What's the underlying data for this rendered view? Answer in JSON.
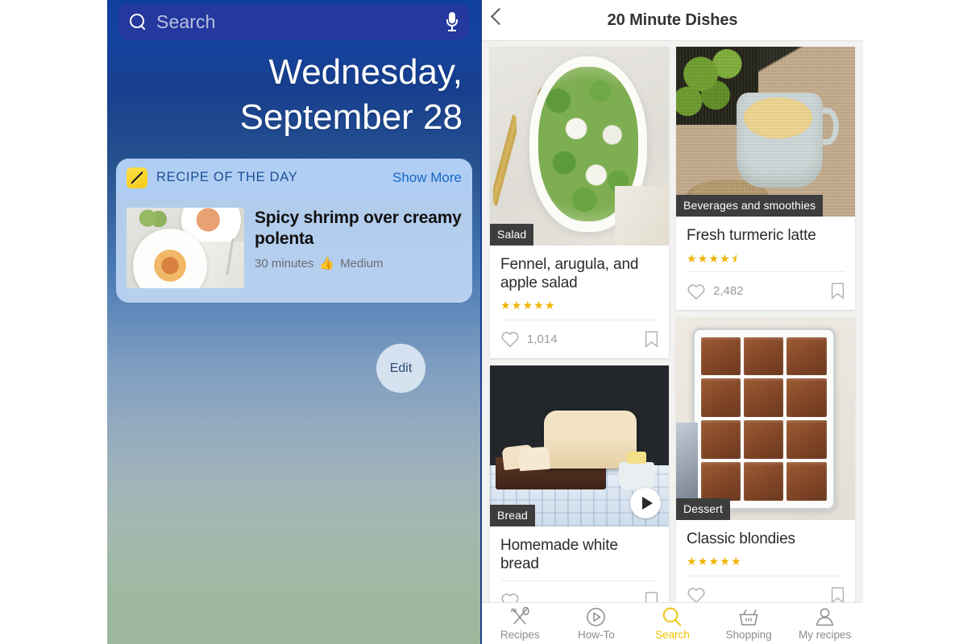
{
  "left_phone": {
    "search": {
      "placeholder": "Search",
      "icon": "search-icon",
      "mic_icon": "microphone-icon"
    },
    "date": {
      "line1": "Wednesday,",
      "line2": "September 28"
    },
    "widget": {
      "app_icon": "recipe-whisk-icon",
      "title": "RECIPE OF THE DAY",
      "show_more": "Show More",
      "recipe": {
        "name": "Spicy shrimp over creamy polenta",
        "time": "30 minutes",
        "difficulty_icon": "thumbs-up-icon",
        "difficulty": "Medium",
        "thumbnail": "spicy-shrimp-polenta-photo"
      }
    },
    "edit_button": "Edit"
  },
  "right_phone": {
    "header": {
      "back_icon": "chevron-left-icon",
      "title": "20 Minute Dishes"
    },
    "cards": [
      {
        "photo": "fennel-arugula-apple-salad-photo",
        "tag": "Salad",
        "title": "Fennel, arugula, and apple salad",
        "rating": 5,
        "rating_display": "★★★★★",
        "likes": "1,014",
        "has_video": false,
        "like_icon": "heart-icon",
        "save_icon": "bookmark-icon"
      },
      {
        "photo": "fresh-turmeric-latte-photo",
        "tag": "Beverages and smoothies",
        "title": "Fresh turmeric latte",
        "rating": 4.5,
        "rating_display": "★★★★⯨",
        "likes": "2,482",
        "has_video": false,
        "like_icon": "heart-icon",
        "save_icon": "bookmark-icon"
      },
      {
        "photo": "homemade-white-bread-photo",
        "tag": "Bread",
        "title": "Homemade white bread",
        "rating": null,
        "rating_display": "",
        "likes": "",
        "has_video": true,
        "video_icon": "play-icon",
        "like_icon": "heart-icon",
        "save_icon": "bookmark-icon"
      },
      {
        "photo": "classic-blondies-photo",
        "tag": "Dessert",
        "title": "Classic blondies",
        "rating": 5,
        "rating_display": "★★★★★",
        "likes": "",
        "has_video": false,
        "like_icon": "heart-icon",
        "save_icon": "bookmark-icon"
      }
    ],
    "nav": [
      {
        "label": "Recipes",
        "icon": "fork-spoon-icon",
        "active": false
      },
      {
        "label": "How-To",
        "icon": "play-circle-icon",
        "active": false
      },
      {
        "label": "Search",
        "icon": "search-icon",
        "active": true
      },
      {
        "label": "Shopping",
        "icon": "shopping-basket-icon",
        "active": false
      },
      {
        "label": "My recipes",
        "icon": "person-icon",
        "active": false
      }
    ]
  },
  "colors": {
    "accent_yellow": "#f0c200",
    "star_gold": "#f0b400",
    "ios_blue": "#24389d",
    "widget_blue": "#1d4f96",
    "tag_dark": "#3d3d3d"
  }
}
